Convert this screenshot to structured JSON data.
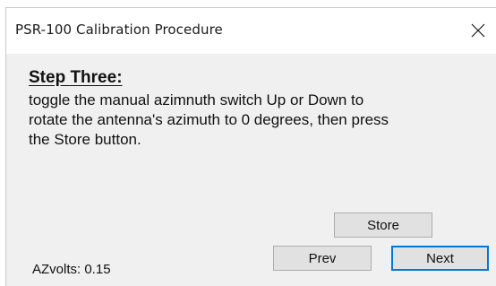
{
  "window": {
    "title": "PSR-100 Calibration Procedure",
    "close_glyph": "×"
  },
  "step": {
    "heading": "Step Three:",
    "instructions": "toggle the manual azimnuth switch Up or Down to rotate the antenna's azimuth to 0 degrees, then press the Store button."
  },
  "buttons": {
    "store_label": "Store",
    "prev_label": "Prev",
    "next_label": "Next"
  },
  "status": {
    "azvolts_text": "AZvolts: 0.15"
  },
  "icons": {
    "close": "close-icon"
  },
  "colors": {
    "dialog_background": "#f0f0f0",
    "titlebar_background": "#ffffff",
    "default_button_border": "#0078d7",
    "button_face": "#e1e1e1"
  }
}
